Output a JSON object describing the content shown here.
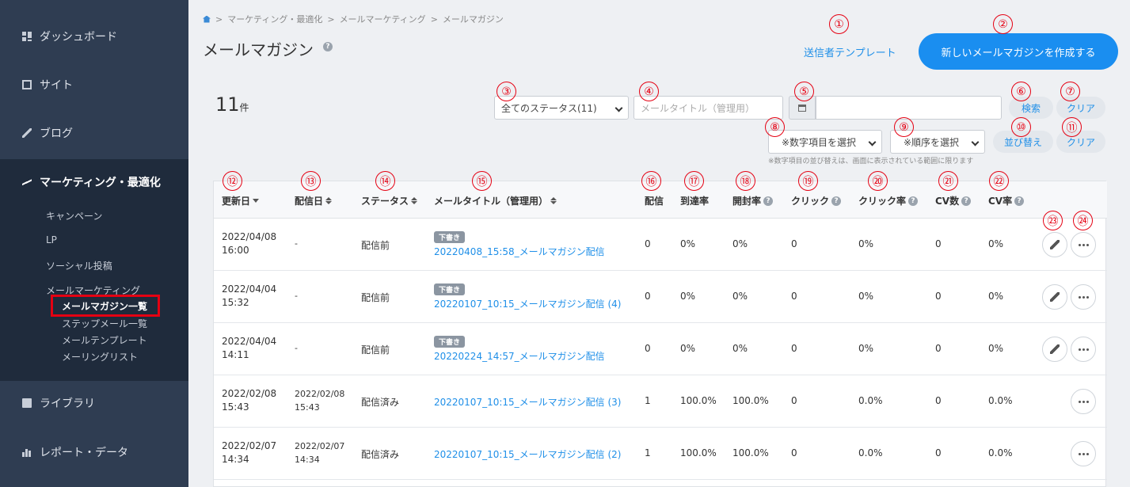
{
  "sidebar": {
    "items": [
      {
        "label": "ダッシュボード",
        "icon": "dashboard-icon"
      },
      {
        "label": "サイト",
        "icon": "site-icon"
      },
      {
        "label": "ブログ",
        "icon": "pencil-icon"
      },
      {
        "label": "マーケティング・最適化",
        "icon": "trend-icon"
      },
      {
        "label": "ライブラリ",
        "icon": "image-icon"
      },
      {
        "label": "レポート・データ",
        "icon": "bar-chart-icon"
      }
    ],
    "sub_items": [
      "キャンペーン",
      "LP",
      "ソーシャル投稿",
      "メールマーケティング"
    ],
    "subsub_items": [
      "メールマガジン一覧",
      "ステップメール一覧",
      "メールテンプレート",
      "メーリングリスト"
    ]
  },
  "breadcrumb": [
    "マーケティング・最適化",
    "メールマーケティング",
    "メールマガジン"
  ],
  "breadcrumb_sep": ">",
  "page_title": "メールマガジン",
  "help_glyph": "?",
  "header": {
    "template_link": "送信者テンプレート",
    "create_button": "新しいメールマガジンを作成する"
  },
  "count": {
    "value": "11",
    "unit": "件"
  },
  "filters": {
    "status_select": "全てのステータス(11)",
    "title_placeholder": "メールタイトル（管理用）",
    "date_value": "",
    "search_button": "検索",
    "clear_button": "クリア",
    "numeric_select": "※数字項目を選択",
    "order_select": "※順序を選択",
    "sort_button": "並び替え",
    "sort_clear_button": "クリア",
    "note": "※数字項目の並び替えは、画面に表示されている範囲に限ります"
  },
  "table": {
    "headers": {
      "updated": "更新日",
      "sent": "配信日",
      "status": "ステータス",
      "title": "メールタイトル（管理用）",
      "delivered": "配信",
      "arrival": "到達率",
      "open": "開封率",
      "click": "クリック",
      "click_rate": "クリック率",
      "cv": "CV数",
      "cv_rate": "CV率"
    },
    "draft_badge": "下書き",
    "rows": [
      {
        "updated_date": "2022/04/08",
        "updated_time": "16:00",
        "sent_date": "-",
        "sent_time": "",
        "status": "配信前",
        "draft": true,
        "title": "20220408_15:58_メールマガジン配信",
        "delivered": "0",
        "arrival": "0%",
        "open": "0%",
        "click": "0",
        "click_rate": "0%",
        "cv": "0",
        "cv_rate": "0%",
        "editable": true
      },
      {
        "updated_date": "2022/04/04",
        "updated_time": "15:32",
        "sent_date": "-",
        "sent_time": "",
        "status": "配信前",
        "draft": true,
        "title": "20220107_10:15_メールマガジン配信 (4)",
        "delivered": "0",
        "arrival": "0%",
        "open": "0%",
        "click": "0",
        "click_rate": "0%",
        "cv": "0",
        "cv_rate": "0%",
        "editable": true
      },
      {
        "updated_date": "2022/04/04",
        "updated_time": "14:11",
        "sent_date": "-",
        "sent_time": "",
        "status": "配信前",
        "draft": true,
        "title": "20220224_14:57_メールマガジン配信",
        "delivered": "0",
        "arrival": "0%",
        "open": "0%",
        "click": "0",
        "click_rate": "0%",
        "cv": "0",
        "cv_rate": "0%",
        "editable": true
      },
      {
        "updated_date": "2022/02/08",
        "updated_time": "15:43",
        "sent_date": "2022/02/08",
        "sent_time": "15:43",
        "status": "配信済み",
        "draft": false,
        "title": "20220107_10:15_メールマガジン配信 (3)",
        "delivered": "1",
        "arrival": "100.0%",
        "open": "100.0%",
        "click": "0",
        "click_rate": "0.0%",
        "cv": "0",
        "cv_rate": "0.0%",
        "editable": false
      },
      {
        "updated_date": "2022/02/07",
        "updated_time": "14:34",
        "sent_date": "2022/02/07",
        "sent_time": "14:34",
        "status": "配信済み",
        "draft": false,
        "title": "20220107_10:15_メールマガジン配信 (2)",
        "delivered": "1",
        "arrival": "100.0%",
        "open": "100.0%",
        "click": "0",
        "click_rate": "0.0%",
        "cv": "0",
        "cv_rate": "0.0%",
        "editable": false
      }
    ]
  },
  "annotations": [
    "①",
    "②",
    "③",
    "④",
    "⑤",
    "⑥",
    "⑦",
    "⑧",
    "⑨",
    "⑩",
    "⑪",
    "⑫",
    "⑬",
    "⑭",
    "⑮",
    "⑯",
    "⑰",
    "⑱",
    "⑲",
    "⑳",
    "㉑",
    "㉒",
    "㉓",
    "㉔"
  ],
  "colors": {
    "accent": "#1a8ef0",
    "sidebar": "#2f3d52",
    "annotation": "#e50012",
    "highlight_box": "#e50012"
  }
}
